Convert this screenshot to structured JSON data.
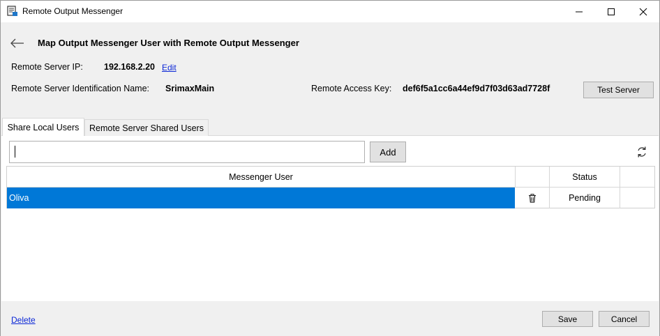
{
  "window": {
    "title": "Remote Output Messenger",
    "icon": "messenger-app-icon",
    "controls": [
      "minimize-icon",
      "maximize-icon",
      "close-icon"
    ]
  },
  "header": {
    "title": "Map Output Messenger User with Remote Output Messenger",
    "back_icon": "back-arrow-icon"
  },
  "server": {
    "ip_label": "Remote Server IP:",
    "ip_value": "192.168.2.20",
    "edit_link": "Edit",
    "id_label": "Remote Server Identification Name:",
    "id_value": "SrimaxMain",
    "key_label": "Remote Access Key:",
    "key_value": "def6f5a1cc6a44ef9d7f03d63ad7728f",
    "test_button": "Test Server"
  },
  "tabs": [
    {
      "label": "Share Local Users",
      "active": true
    },
    {
      "label": "Remote Server Shared Users",
      "active": false
    }
  ],
  "toolbar": {
    "search_value": "",
    "add_button": "Add",
    "refresh_icon": "refresh-icon"
  },
  "grid": {
    "columns": [
      "Messenger User",
      "",
      "Status",
      ""
    ],
    "rows": [
      {
        "user": "Oliva",
        "delete_icon": "trash-icon",
        "status": "Pending"
      }
    ],
    "selected_color": "#0078d7"
  },
  "footer": {
    "delete_link": "Delete",
    "save_button": "Save",
    "cancel_button": "Cancel"
  }
}
